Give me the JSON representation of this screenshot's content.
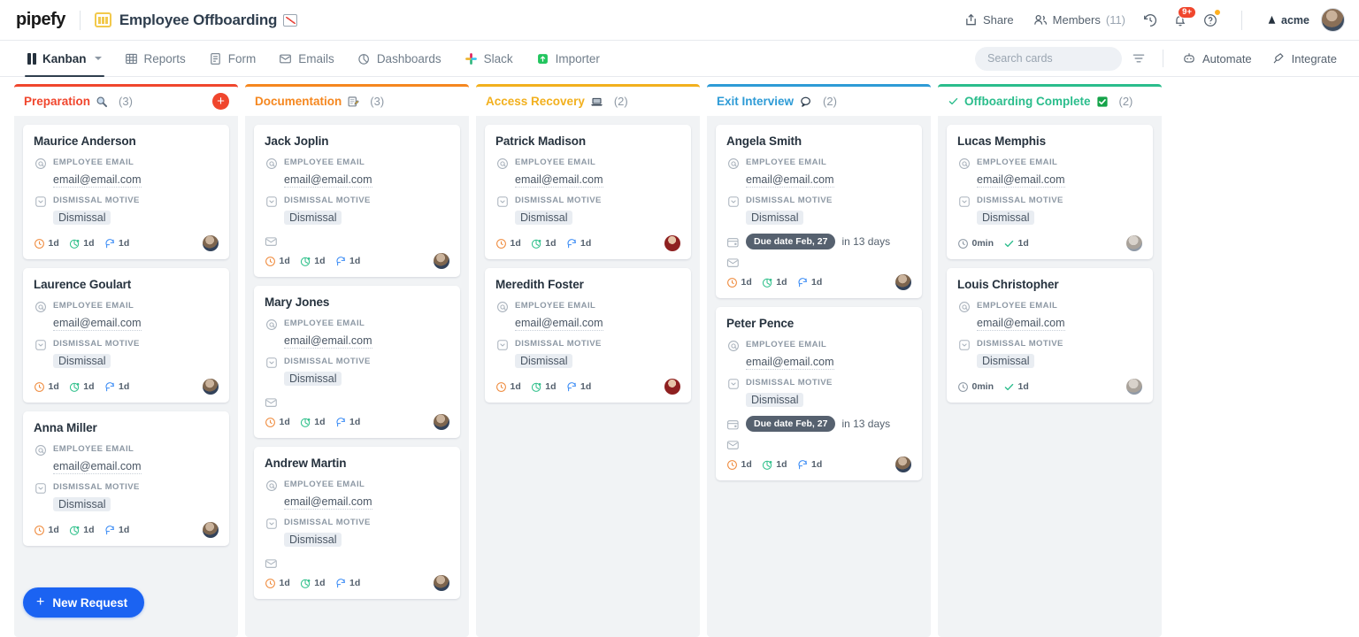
{
  "topbar": {
    "logo": "pipefy",
    "board_icon": "kanban-board-icon",
    "board_title": "Employee Offboarding",
    "title_emoji": "chart-increasing-emoji",
    "share_label": "Share",
    "members_label": "Members",
    "members_count": "(11)",
    "history_icon": "clock-history-icon",
    "notifications_icon": "bell-icon",
    "notifications_badge": "9+",
    "help_icon": "help-circle-icon",
    "org_name": "acme",
    "avatar": "user-avatar"
  },
  "nav": {
    "tabs": [
      {
        "label": "Kanban",
        "icon": "kanban-icon",
        "active": true,
        "has_chevron": true
      },
      {
        "label": "Reports",
        "icon": "table-icon",
        "active": false
      },
      {
        "label": "Form",
        "icon": "form-icon",
        "active": false
      },
      {
        "label": "Emails",
        "icon": "envelope-icon",
        "active": false
      },
      {
        "label": "Dashboards",
        "icon": "pie-chart-icon",
        "active": false
      },
      {
        "label": "Slack",
        "icon": "slack-icon",
        "active": false
      },
      {
        "label": "Importer",
        "icon": "importer-icon",
        "active": false
      }
    ],
    "search": {
      "placeholder": "Search cards",
      "value": "",
      "icon": "search-icon"
    },
    "filter_icon": "filter-icon",
    "automate_label": "Automate",
    "automate_icon": "robot-icon",
    "integrate_label": "Integrate",
    "integrate_icon": "integrate-icon"
  },
  "field_labels": {
    "email": "EMPLOYEE EMAIL",
    "motive": "DISMISSAL MOTIVE"
  },
  "footer": {
    "new_request_label": "New Request"
  },
  "columns": [
    {
      "title": "Preparation",
      "emoji": "magnifying-glass",
      "count": "(3)",
      "accent": "#f0462d",
      "has_add": true,
      "has_check": false,
      "cards": [
        {
          "name": "Maurice Anderson",
          "email": "email@email.com",
          "motive": "Dismissal",
          "avatar": "default",
          "has_envelope": false,
          "due": null,
          "metrics": [
            {
              "icon": "clock-icon",
              "color": "#ef8a3c",
              "value": "1d"
            },
            {
              "icon": "pie-clock-icon",
              "color": "#2fc08b",
              "value": "1d"
            },
            {
              "icon": "cycle-icon",
              "color": "#3b8cf5",
              "value": "1d"
            }
          ]
        },
        {
          "name": "Laurence Goulart",
          "email": "email@email.com",
          "motive": "Dismissal",
          "avatar": "default",
          "has_envelope": false,
          "due": null,
          "metrics": [
            {
              "icon": "clock-icon",
              "color": "#ef8a3c",
              "value": "1d"
            },
            {
              "icon": "pie-clock-icon",
              "color": "#2fc08b",
              "value": "1d"
            },
            {
              "icon": "cycle-icon",
              "color": "#3b8cf5",
              "value": "1d"
            }
          ]
        },
        {
          "name": "Anna Miller",
          "email": "email@email.com",
          "motive": "Dismissal",
          "avatar": "default",
          "has_envelope": false,
          "due": null,
          "metrics": [
            {
              "icon": "clock-icon",
              "color": "#ef8a3c",
              "value": "1d"
            },
            {
              "icon": "pie-clock-icon",
              "color": "#2fc08b",
              "value": "1d"
            },
            {
              "icon": "cycle-icon",
              "color": "#3b8cf5",
              "value": "1d"
            }
          ]
        }
      ]
    },
    {
      "title": "Documentation",
      "emoji": "memo",
      "count": "(3)",
      "accent": "#f5871f",
      "has_add": false,
      "has_check": false,
      "cards": [
        {
          "name": "Jack Joplin",
          "email": "email@email.com",
          "motive": "Dismissal",
          "avatar": "default",
          "has_envelope": true,
          "due": null,
          "metrics": [
            {
              "icon": "clock-icon",
              "color": "#ef8a3c",
              "value": "1d"
            },
            {
              "icon": "pie-clock-icon",
              "color": "#2fc08b",
              "value": "1d"
            },
            {
              "icon": "cycle-icon",
              "color": "#3b8cf5",
              "value": "1d"
            }
          ]
        },
        {
          "name": "Mary Jones",
          "email": "email@email.com",
          "motive": "Dismissal",
          "avatar": "default",
          "has_envelope": true,
          "due": null,
          "metrics": [
            {
              "icon": "clock-icon",
              "color": "#ef8a3c",
              "value": "1d"
            },
            {
              "icon": "pie-clock-icon",
              "color": "#2fc08b",
              "value": "1d"
            },
            {
              "icon": "cycle-icon",
              "color": "#3b8cf5",
              "value": "1d"
            }
          ]
        },
        {
          "name": "Andrew Martin",
          "email": "email@email.com",
          "motive": "Dismissal",
          "avatar": "default",
          "has_envelope": true,
          "due": null,
          "metrics": [
            {
              "icon": "clock-icon",
              "color": "#ef8a3c",
              "value": "1d"
            },
            {
              "icon": "pie-clock-icon",
              "color": "#2fc08b",
              "value": "1d"
            },
            {
              "icon": "cycle-icon",
              "color": "#3b8cf5",
              "value": "1d"
            }
          ]
        }
      ]
    },
    {
      "title": "Access Recovery",
      "emoji": "laptop",
      "count": "(2)",
      "accent": "#f2b01e",
      "has_add": false,
      "has_check": false,
      "cards": [
        {
          "name": "Patrick Madison",
          "email": "email@email.com",
          "motive": "Dismissal",
          "avatar": "dark",
          "has_envelope": false,
          "due": null,
          "metrics": [
            {
              "icon": "clock-icon",
              "color": "#ef8a3c",
              "value": "1d"
            },
            {
              "icon": "pie-clock-icon",
              "color": "#2fc08b",
              "value": "1d"
            },
            {
              "icon": "cycle-icon",
              "color": "#3b8cf5",
              "value": "1d"
            }
          ]
        },
        {
          "name": "Meredith Foster",
          "email": "email@email.com",
          "motive": "Dismissal",
          "avatar": "dark",
          "has_envelope": false,
          "due": null,
          "metrics": [
            {
              "icon": "clock-icon",
              "color": "#ef8a3c",
              "value": "1d"
            },
            {
              "icon": "pie-clock-icon",
              "color": "#2fc08b",
              "value": "1d"
            },
            {
              "icon": "cycle-icon",
              "color": "#3b8cf5",
              "value": "1d"
            }
          ]
        }
      ]
    },
    {
      "title": "Exit Interview",
      "emoji": "speech-balloon",
      "count": "(2)",
      "accent": "#2e9bd6",
      "has_add": false,
      "has_check": false,
      "cards": [
        {
          "name": "Angela Smith",
          "email": "email@email.com",
          "motive": "Dismissal",
          "avatar": "default",
          "has_envelope": true,
          "due": {
            "pill": "Due date Feb, 27",
            "text": "in 13 days"
          },
          "metrics": [
            {
              "icon": "clock-icon",
              "color": "#ef8a3c",
              "value": "1d"
            },
            {
              "icon": "pie-clock-icon",
              "color": "#2fc08b",
              "value": "1d"
            },
            {
              "icon": "cycle-icon",
              "color": "#3b8cf5",
              "value": "1d"
            }
          ]
        },
        {
          "name": "Peter Pence",
          "email": "email@email.com",
          "motive": "Dismissal",
          "avatar": "default",
          "has_envelope": true,
          "due": {
            "pill": "Due date Feb, 27",
            "text": "in 13 days"
          },
          "metrics": [
            {
              "icon": "clock-icon",
              "color": "#ef8a3c",
              "value": "1d"
            },
            {
              "icon": "pie-clock-icon",
              "color": "#2fc08b",
              "value": "1d"
            },
            {
              "icon": "cycle-icon",
              "color": "#3b8cf5",
              "value": "1d"
            }
          ]
        }
      ]
    },
    {
      "title": "Offboarding Complete",
      "emoji": "check-mark-button",
      "count": "(2)",
      "accent": "#2bbd8c",
      "has_add": false,
      "has_check": true,
      "cards": [
        {
          "name": "Lucas Memphis",
          "email": "email@email.com",
          "motive": "Dismissal",
          "avatar": "light",
          "has_envelope": false,
          "due": null,
          "metrics": [
            {
              "icon": "clock-icon",
              "color": "#8d98a4",
              "value": "0min"
            },
            {
              "icon": "check-icon",
              "color": "#2bbd8c",
              "value": "1d"
            }
          ]
        },
        {
          "name": "Louis Christopher",
          "email": "email@email.com",
          "motive": "Dismissal",
          "avatar": "light",
          "has_envelope": false,
          "due": null,
          "metrics": [
            {
              "icon": "clock-icon",
              "color": "#8d98a4",
              "value": "0min"
            },
            {
              "icon": "check-icon",
              "color": "#2bbd8c",
              "value": "1d"
            }
          ]
        }
      ]
    }
  ]
}
